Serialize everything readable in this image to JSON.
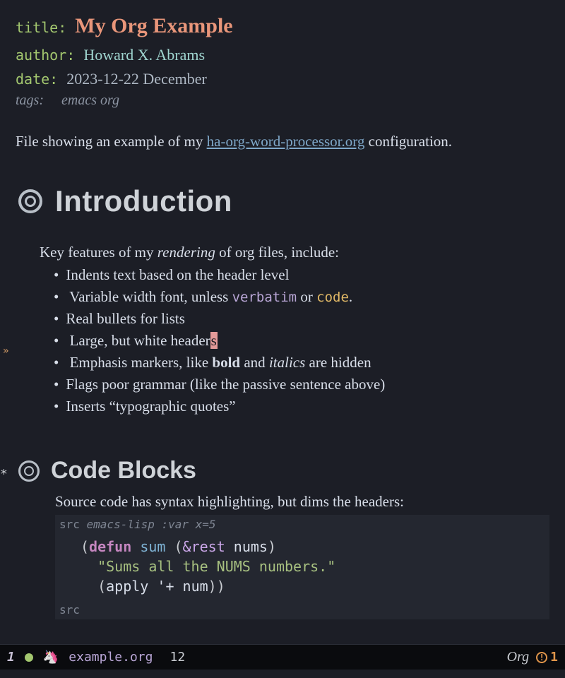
{
  "meta": {
    "title_key": "title:",
    "title_val": "My Org Example",
    "author_key": "author:",
    "author_val": "Howard X. Abrams",
    "date_key": "date:",
    "date_val": "2023-12-22 December",
    "tags_key": "tags:",
    "tags_val": "emacs org"
  },
  "intro": {
    "before": "File showing an example of my ",
    "link": "ha-org-word-processor.org",
    "after": " configuration."
  },
  "headings": {
    "intro": "Introduction",
    "code": "Code Blocks"
  },
  "features": {
    "lead_before": "Key features of my ",
    "lead_em": "rendering",
    "lead_after": " of org files, include:",
    "items": {
      "i0": "Indents text based on the header level",
      "i1_before": "Variable width font, unless ",
      "i1_verbatim": "verbatim",
      "i1_mid": " or ",
      "i1_code": "code",
      "i1_after": ".",
      "i2": "Real bullets for lists",
      "i3_before": "Large, but white header",
      "i3_cursor": "s",
      "i4_before": "Emphasis markers, like ",
      "i4_bold": "bold",
      "i4_mid": " and ",
      "i4_italic": "italics",
      "i4_after": " are hidden",
      "i5": "Flags poor grammar (like the passive sentence above)",
      "i6": "Inserts “typographic quotes”"
    }
  },
  "src": {
    "lead": "Source code has syntax highlighting, but dims the headers:",
    "header_prefix": "src ",
    "header_lang": "emacs-lisp :var x=5",
    "footer": "src",
    "code": {
      "l1_open": "(",
      "l1_defun": "defun",
      "l1_sp1": " ",
      "l1_name": "sum",
      "l1_sp2": " ",
      "l1_p2": "(",
      "l1_amp": "&rest",
      "l1_sp3": " ",
      "l1_var": "nums",
      "l1_p3": ")",
      "l2_indent": "  ",
      "l2_str": "\"Sums all the NUMS numbers.\"",
      "l3_indent": "  ",
      "l3_p": "(",
      "l3_apply": "apply ",
      "l3_q": "'",
      "l3_plus": "+ ",
      "l3_num": "num",
      "l3_close": "))"
    }
  },
  "modeline": {
    "winnum": "1",
    "unicorn": "🦄",
    "filename": "example.org",
    "line": "12",
    "mode": "Org",
    "warn_count": "1"
  },
  "fringe": {
    "mark": "»"
  },
  "h2_star": "*"
}
